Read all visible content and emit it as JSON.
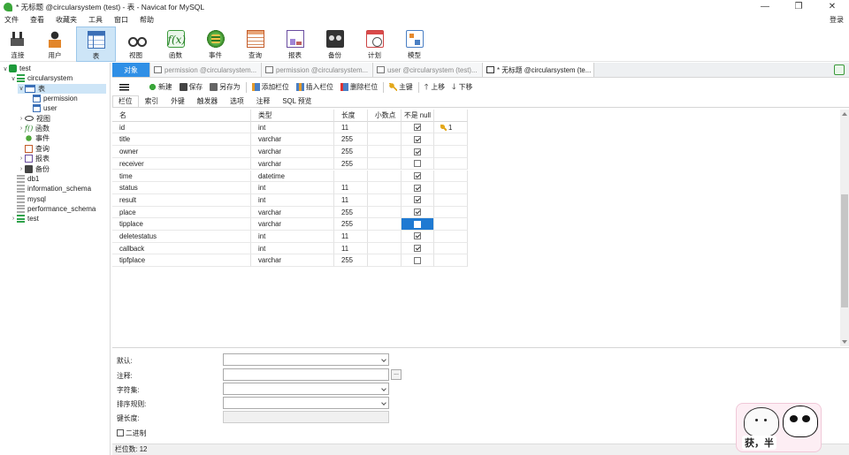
{
  "window": {
    "title": "* 无标题 @circularsystem (test) - 表 - Navicat for MySQL",
    "controls": [
      "—",
      "❐",
      "✕"
    ]
  },
  "menu": {
    "items": [
      "文件",
      "查看",
      "收藏夹",
      "工具",
      "窗口",
      "帮助"
    ],
    "login": "登录"
  },
  "toolbar": {
    "buttons": [
      {
        "label": "连接",
        "icon": "connection-icon"
      },
      {
        "label": "用户",
        "icon": "user-icon"
      },
      {
        "label": "表",
        "icon": "table-icon",
        "active": true
      },
      {
        "label": "视图",
        "icon": "view-icon"
      },
      {
        "label": "函数",
        "icon": "function-icon"
      },
      {
        "label": "事件",
        "icon": "event-icon"
      },
      {
        "label": "查询",
        "icon": "query-icon"
      },
      {
        "label": "报表",
        "icon": "report-icon"
      },
      {
        "label": "备份",
        "icon": "backup-icon"
      },
      {
        "label": "计划",
        "icon": "schedule-icon"
      },
      {
        "label": "模型",
        "icon": "model-icon"
      }
    ]
  },
  "sidebar": {
    "items": [
      {
        "label": "test",
        "level": 0,
        "arrow": "∨",
        "icon": "connection-icon"
      },
      {
        "label": "circularsystem",
        "level": 1,
        "arrow": "∨",
        "icon": "database-icon"
      },
      {
        "label": "表",
        "level": 2,
        "arrow": "∨",
        "icon": "tables-icon",
        "selected": true
      },
      {
        "label": "permission",
        "level": 3,
        "arrow": "",
        "icon": "table-icon"
      },
      {
        "label": "user",
        "level": 3,
        "arrow": "",
        "icon": "table-icon"
      },
      {
        "label": "视图",
        "level": 2,
        "arrow": "›",
        "icon": "view-icon"
      },
      {
        "label": "函数",
        "level": 2,
        "arrow": "›",
        "icon": "function-icon"
      },
      {
        "label": "事件",
        "level": 2,
        "arrow": "",
        "icon": "event-icon"
      },
      {
        "label": "查询",
        "level": 2,
        "arrow": "",
        "icon": "query-icon"
      },
      {
        "label": "报表",
        "level": 2,
        "arrow": "›",
        "icon": "report-icon"
      },
      {
        "label": "备份",
        "level": 2,
        "arrow": "›",
        "icon": "backup-icon"
      },
      {
        "label": "db1",
        "level": 1,
        "arrow": "",
        "icon": "database-gray-icon"
      },
      {
        "label": "information_schema",
        "level": 1,
        "arrow": "",
        "icon": "database-gray-icon"
      },
      {
        "label": "mysql",
        "level": 1,
        "arrow": "",
        "icon": "database-gray-icon"
      },
      {
        "label": "performance_schema",
        "level": 1,
        "arrow": "",
        "icon": "database-gray-icon"
      },
      {
        "label": "test",
        "level": 1,
        "arrow": "›",
        "icon": "database-icon"
      }
    ]
  },
  "tabs": [
    {
      "label": "对象",
      "kind": "obj"
    },
    {
      "label": "permission @circularsystem...",
      "kind": "normal"
    },
    {
      "label": "permission @circularsystem...",
      "kind": "normal"
    },
    {
      "label": "user @circularsystem (test)...",
      "kind": "normal"
    },
    {
      "label": "* 无标题 @circularsystem (te...",
      "kind": "active"
    }
  ],
  "editor_toolbar": {
    "new": "新建",
    "save": "保存",
    "save_as": "另存为",
    "add_column": "添加栏位",
    "insert_column": "插入栏位",
    "delete_column": "删除栏位",
    "primary_key": "主键",
    "move_up": "上移",
    "move_down": "下移"
  },
  "subtabs": [
    "栏位",
    "索引",
    "外键",
    "触发器",
    "选项",
    "注释",
    "SQL 预览"
  ],
  "grid": {
    "headers": {
      "name": "名",
      "type": "类型",
      "length": "长度",
      "decimals": "小数点",
      "not_null": "不是 null",
      "key": ""
    },
    "rows": [
      {
        "name": "id",
        "type": "int",
        "length": "11",
        "not_null": true,
        "key": "1"
      },
      {
        "name": "title",
        "type": "varchar",
        "length": "255",
        "not_null": true,
        "key": ""
      },
      {
        "name": "owner",
        "type": "varchar",
        "length": "255",
        "not_null": true,
        "key": ""
      },
      {
        "name": "receiver",
        "type": "varchar",
        "length": "255",
        "not_null": false,
        "key": ""
      },
      {
        "name": "time",
        "type": "datetime",
        "length": "",
        "not_null": true,
        "key": ""
      },
      {
        "name": "status",
        "type": "int",
        "length": "11",
        "not_null": true,
        "key": ""
      },
      {
        "name": "result",
        "type": "int",
        "length": "11",
        "not_null": true,
        "key": ""
      },
      {
        "name": "place",
        "type": "varchar",
        "length": "255",
        "not_null": true,
        "key": ""
      },
      {
        "name": "tipplace",
        "type": "varchar",
        "length": "255",
        "not_null": false,
        "key": "",
        "current": true
      },
      {
        "name": "deletestatus",
        "type": "int",
        "length": "11",
        "not_null": true,
        "key": ""
      },
      {
        "name": "callback",
        "type": "int",
        "length": "11",
        "not_null": true,
        "key": ""
      },
      {
        "name": "tipfplace",
        "type": "varchar",
        "length": "255",
        "not_null": false,
        "key": ""
      }
    ]
  },
  "properties": {
    "default_label": "默认:",
    "comment_label": "注释:",
    "charset_label": "字符集:",
    "collation_label": "排序规则:",
    "key_length_label": "键长度:",
    "binary_label": "二进制",
    "ellipsis": "..."
  },
  "status": {
    "field_count": "栏位数: 12"
  },
  "sticker": {
    "caption": "获，半"
  },
  "colors": {
    "accent": "#2f8fe6",
    "selection": "#1f7ad2",
    "toolbar_active": "#cde5f7"
  }
}
